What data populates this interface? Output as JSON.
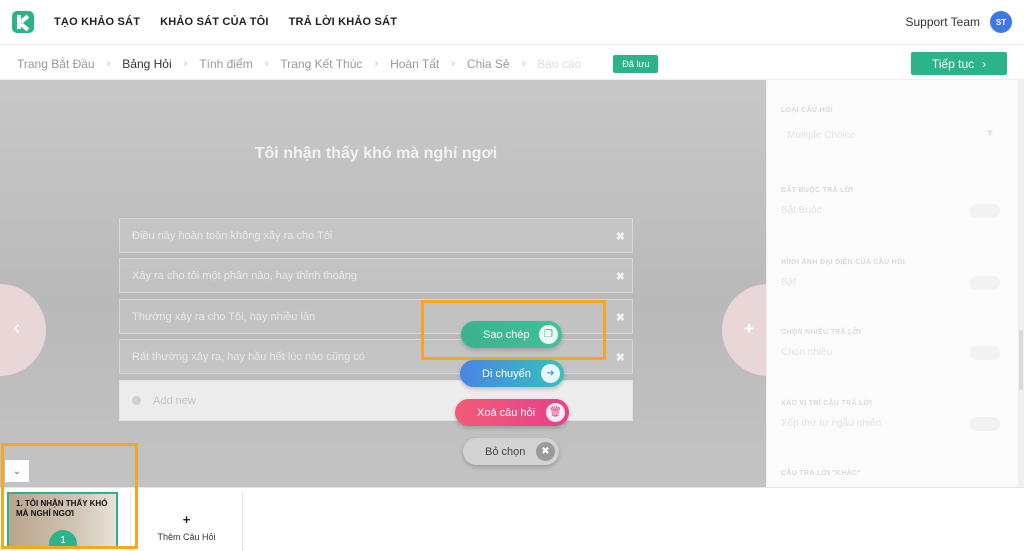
{
  "nav": {
    "items": [
      "TẠO KHẢO SÁT",
      "KHẢO SÁT CỦA TÔI",
      "TRẢ LỜI KHẢO SÁT"
    ],
    "user_name": "Support Team",
    "avatar_initials": "ST"
  },
  "steps": {
    "items": [
      "Trang Bắt Đầu",
      "Bảng Hỏi",
      "Tính điểm",
      "Trang Kết Thúc",
      "Hoàn Tất",
      "Chia Sẻ",
      "Báo cáo"
    ],
    "active_index": 1,
    "saved_label": "Đã lưu",
    "continue_label": "Tiếp tục"
  },
  "question": {
    "title": "Tôi nhận thấy khó mà nghỉ ngơi",
    "answers": [
      "Điều này hoàn toàn không xảy ra cho Tôi",
      "Xảy ra cho tôi một phần nào, hay thỉnh thoảng",
      "Thường xảy ra cho Tôi, hay nhiều lần",
      "Rất thường xảy ra, hay hầu hết lúc nào cũng có"
    ],
    "add_new_placeholder": "Add new"
  },
  "actions": {
    "copy": "Sao chép",
    "move": "Di chuyển",
    "delete": "Xoá câu hỏi",
    "deselect": "Bỏ chọn"
  },
  "panel": {
    "question_type_label": "LOẠI CÂU HỎI",
    "question_type_value": "Multiple Choice",
    "required_label": "BẮT BUỘC TRẢ LỜI",
    "required_value": "Bắt Buộc",
    "image_label": "HÌNH ẢNH ĐẠI DIỆN CỦA CÂU HỎI",
    "image_value": "Bật",
    "multi_label": "CHỌN NHIỀU TRẢ LỜI",
    "multi_value": "Chọn nhiều",
    "shuffle_label": "XÁO VỊ TRÍ CÂU TRẢ LỜI",
    "shuffle_value": "Xếp thứ tự ngẫu nhiên",
    "other_label": "CÂU TRẢ LỜI \"KHÁC\""
  },
  "bottom": {
    "thumb_title": "1. TÔI NHẬN THẤY KHÓ MÀ NGHỈ NGƠI",
    "thumb_number": "1",
    "add_question_label": "Thêm Câu Hỏi"
  },
  "icons": {
    "copy": "copy-icon",
    "move": "arrow-right-icon",
    "delete": "trash-icon",
    "deselect": "close-icon"
  },
  "colors": {
    "brand": "#2db38a",
    "highlight": "#f5a623",
    "delete": "#e8408a",
    "move": "#4a84e6"
  }
}
